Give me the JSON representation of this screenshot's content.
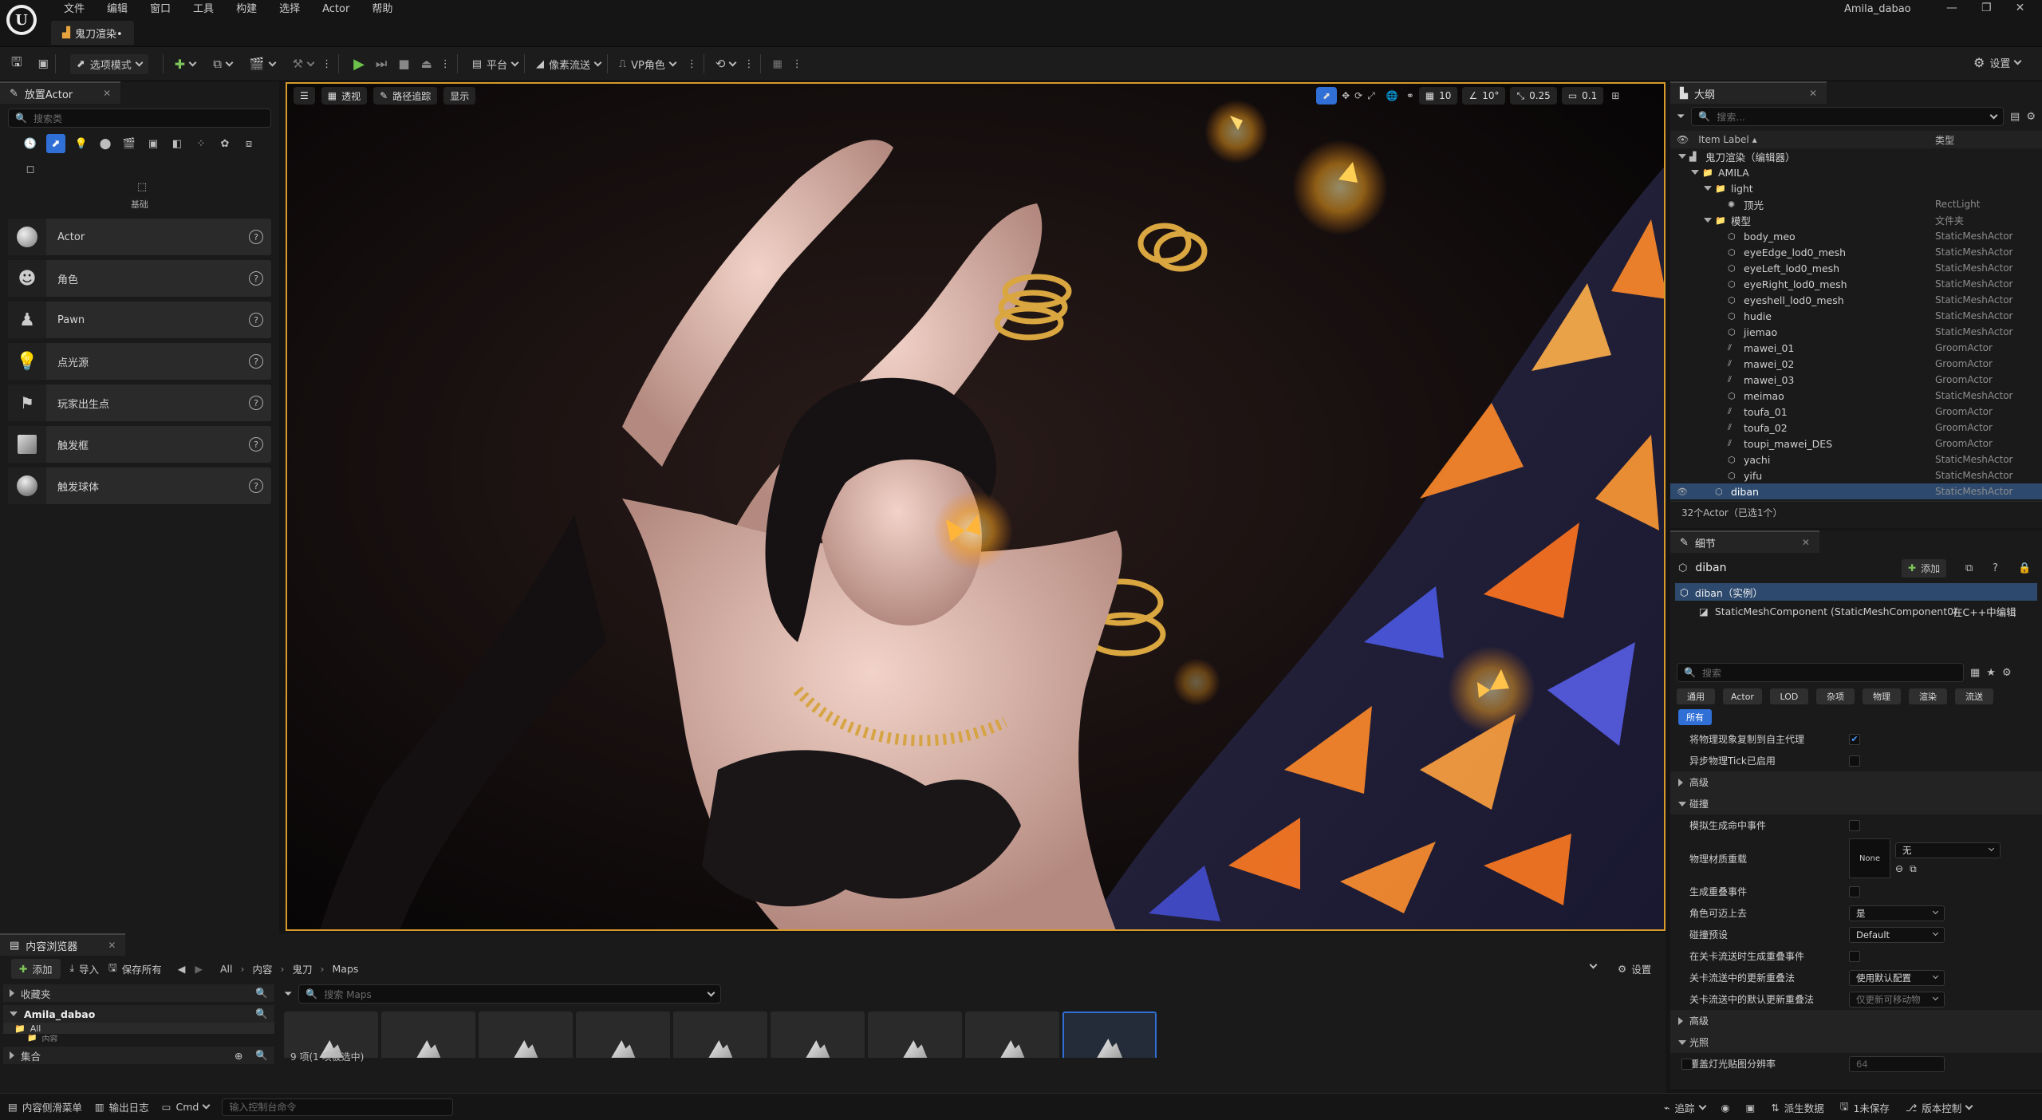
{
  "menubar": {
    "items": [
      "文件",
      "编辑",
      "窗口",
      "工具",
      "构建",
      "选择",
      "Actor",
      "帮助"
    ],
    "user": "Amila_dabao",
    "level_tab": "鬼刀渲染•"
  },
  "toolbar": {
    "select_mode": "选项模式",
    "platform": "平台",
    "pixel_streaming": "像素流送",
    "vp_role": "VP角色",
    "settings": "设置"
  },
  "place_actors": {
    "tab": "放置Actor",
    "search_placeholder": "搜索类",
    "category_label": "基础",
    "items": [
      "Actor",
      "角色",
      "Pawn",
      "点光源",
      "玩家出生点",
      "触发框",
      "触发球体"
    ]
  },
  "viewport": {
    "perspective": "透视",
    "path_tracing": "路径追踪",
    "show": "显示",
    "grid_snap": "10",
    "rot_snap": "10°",
    "scale_snap": "0.25",
    "camera_speed": "0.1"
  },
  "outliner": {
    "tab": "大纲",
    "search_placeholder": "搜索...",
    "col_label": "Item Label",
    "col_type": "类型",
    "rows": [
      {
        "label": "鬼刀渲染（编辑器）",
        "type": "",
        "indent": 0
      },
      {
        "label": "AMILA",
        "type": "",
        "indent": 1
      },
      {
        "label": "light",
        "type": "",
        "indent": 2
      },
      {
        "label": "顶光",
        "type": "RectLight",
        "indent": 3
      },
      {
        "label": "模型",
        "type": "文件夹",
        "indent": 2
      },
      {
        "label": "body_meo",
        "type": "StaticMeshActor",
        "indent": 3
      },
      {
        "label": "eyeEdge_lod0_mesh",
        "type": "StaticMeshActor",
        "indent": 3
      },
      {
        "label": "eyeLeft_lod0_mesh",
        "type": "StaticMeshActor",
        "indent": 3
      },
      {
        "label": "eyeRight_lod0_mesh",
        "type": "StaticMeshActor",
        "indent": 3
      },
      {
        "label": "eyeshell_lod0_mesh",
        "type": "StaticMeshActor",
        "indent": 3
      },
      {
        "label": "hudie",
        "type": "StaticMeshActor",
        "indent": 3
      },
      {
        "label": "jiemao",
        "type": "StaticMeshActor",
        "indent": 3
      },
      {
        "label": "mawei_01",
        "type": "GroomActor",
        "indent": 3
      },
      {
        "label": "mawei_02",
        "type": "GroomActor",
        "indent": 3
      },
      {
        "label": "mawei_03",
        "type": "GroomActor",
        "indent": 3
      },
      {
        "label": "meimao",
        "type": "StaticMeshActor",
        "indent": 3
      },
      {
        "label": "toufa_01",
        "type": "GroomActor",
        "indent": 3
      },
      {
        "label": "toufa_02",
        "type": "GroomActor",
        "indent": 3
      },
      {
        "label": "toupi_mawei_DES",
        "type": "GroomActor",
        "indent": 3
      },
      {
        "label": "yachi",
        "type": "StaticMeshActor",
        "indent": 3
      },
      {
        "label": "yifu",
        "type": "StaticMeshActor",
        "indent": 3
      },
      {
        "label": "diban",
        "type": "StaticMeshActor",
        "indent": 2
      }
    ],
    "footer": "32个Actor（已选1个）"
  },
  "details": {
    "tab": "细节",
    "object_name": "diban",
    "add_button": "添加",
    "instance": "diban（实例）",
    "component": "StaticMeshComponent (StaticMeshComponent0)",
    "edit_cpp": "在C++中编辑",
    "search_placeholder": "搜索",
    "filter_tabs": [
      "通用",
      "Actor",
      "LOD",
      "杂项",
      "物理",
      "渲染",
      "流送"
    ],
    "filter_all": "所有",
    "props": [
      {
        "name": "将物理现象复制到自主代理",
        "kind": "check",
        "checked": true
      },
      {
        "name": "异步物理Tick已启用",
        "kind": "check",
        "checked": false
      },
      {
        "name": "高级",
        "kind": "section"
      },
      {
        "name": "碰撞",
        "kind": "section-open"
      },
      {
        "name": "模拟生成命中事件",
        "kind": "check",
        "checked": false
      },
      {
        "name": "物理材质重载",
        "kind": "material",
        "value": "无",
        "thumb": "None"
      },
      {
        "name": "生成重叠事件",
        "kind": "check",
        "checked": false
      },
      {
        "name": "角色可迈上去",
        "kind": "combo",
        "value": "是"
      },
      {
        "name": "碰撞预设",
        "kind": "combo",
        "value": "Default"
      },
      {
        "name": "在关卡流送时生成重叠事件",
        "kind": "check",
        "checked": false
      },
      {
        "name": "关卡流送中的更新重叠法",
        "kind": "combo",
        "value": "使用默认配置"
      },
      {
        "name": "关卡流送中的默认更新重叠法",
        "kind": "combo-dim",
        "value": "仅更新可移动物"
      },
      {
        "name": "高级",
        "kind": "section"
      },
      {
        "name": "光照",
        "kind": "section-open"
      },
      {
        "name": "覆盖灯光贴图分辨率",
        "kind": "input-dim",
        "value": "64"
      }
    ]
  },
  "content_browser": {
    "tab": "内容浏览器",
    "add": "添加",
    "import": "导入",
    "save_all": "保存所有",
    "path": [
      "All",
      "内容",
      "鬼刀",
      "Maps"
    ],
    "settings": "设置",
    "favorites": "收藏夹",
    "project": "Amila_dabao",
    "tree": [
      "All",
      "内容"
    ],
    "collections": "集合",
    "search_placeholder": "搜索 Maps",
    "asset_count": 9,
    "footer": "9 项(1 项被选中)"
  },
  "statusbar": {
    "drawer": "内容侧滑菜单",
    "output_log": "输出日志",
    "cmd": "Cmd",
    "cmd_placeholder": "输入控制台命令",
    "trace": "追踪",
    "derived_data": "派生数据",
    "unsaved": "1未保存",
    "source_control": "版本控制"
  }
}
